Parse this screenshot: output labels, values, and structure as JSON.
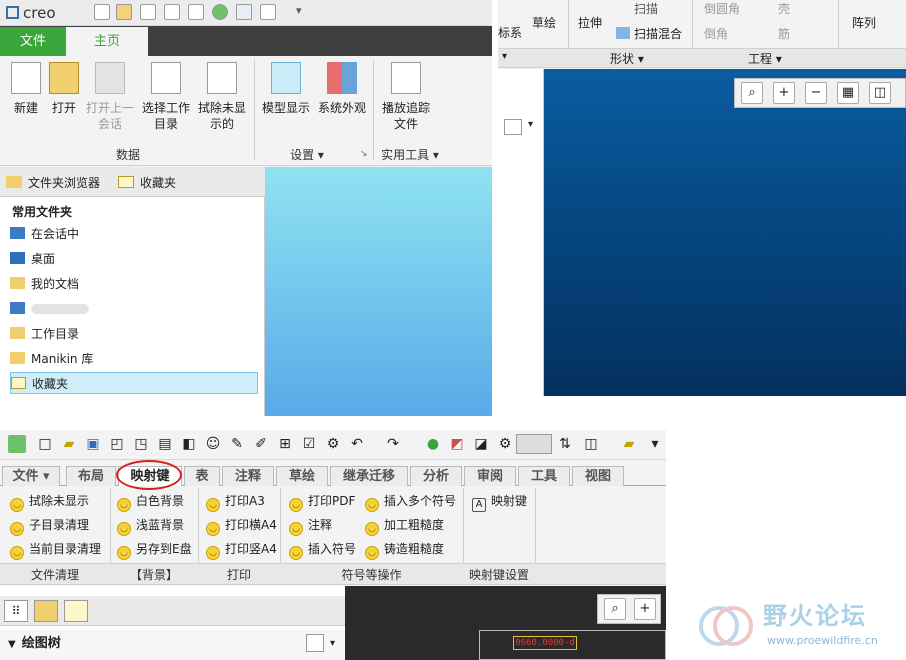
{
  "panel1": {
    "logo": "creo",
    "tabs": {
      "file": "文件",
      "home": "主页"
    },
    "buttons": [
      "新建",
      "打开",
      "打开上一会话",
      "选择工作目录",
      "拭除未显示的",
      "模型显示",
      "系统外观",
      "播放追踪文件"
    ],
    "groups": {
      "data": "数据",
      "settings": "设置 ▾",
      "utilities": "实用工具 ▾"
    },
    "browser_tabs": [
      "文件夹浏览器",
      "收藏夹"
    ],
    "browser_heading": "常用文件夹",
    "folders": [
      "在会话中",
      "桌面",
      "我的文档",
      "",
      "工作目录",
      "Manikin 库",
      "收藏夹"
    ]
  },
  "panel2": {
    "ribbon": [
      "标系",
      "草绘",
      "拉伸",
      "扫描",
      "扫描混合",
      "倒圆角",
      "倒角",
      "壳",
      "筋",
      "阵列"
    ],
    "labels": [
      "形状 ▾",
      "工程 ▾"
    ]
  },
  "panel3": {
    "tabs": [
      "文件 ▾",
      "布局",
      "映射键",
      "表",
      "注释",
      "草绘",
      "继承迁移",
      "分析",
      "审阅",
      "工具",
      "视图"
    ],
    "col1": [
      "拭除未显示",
      "子目录清理",
      "当前目录清理"
    ],
    "col2": [
      "白色背景",
      "浅蓝背景",
      "另存到E盘"
    ],
    "col3": [
      "打印A3",
      "打印横A4",
      "打印竖A4"
    ],
    "col4": [
      "打印PDF",
      "注释",
      "插入符号"
    ],
    "col5": [
      "插入多个符号",
      "加工粗糙度",
      "铸造粗糙度"
    ],
    "col6": [
      "映射键"
    ],
    "group_labels": [
      "文件清理",
      "【背景】",
      "打印",
      "符号等操作",
      "映射键设置"
    ],
    "tree_label": "绘图树",
    "drawing_number": "0660.0000-d"
  },
  "watermark": {
    "name": "野火论坛",
    "url": "www.proewildfire.cn"
  },
  "colors": {
    "file_tab": "#3aa53a",
    "dark_bar": "#3f3f3f",
    "highlight": "#d8201e"
  }
}
